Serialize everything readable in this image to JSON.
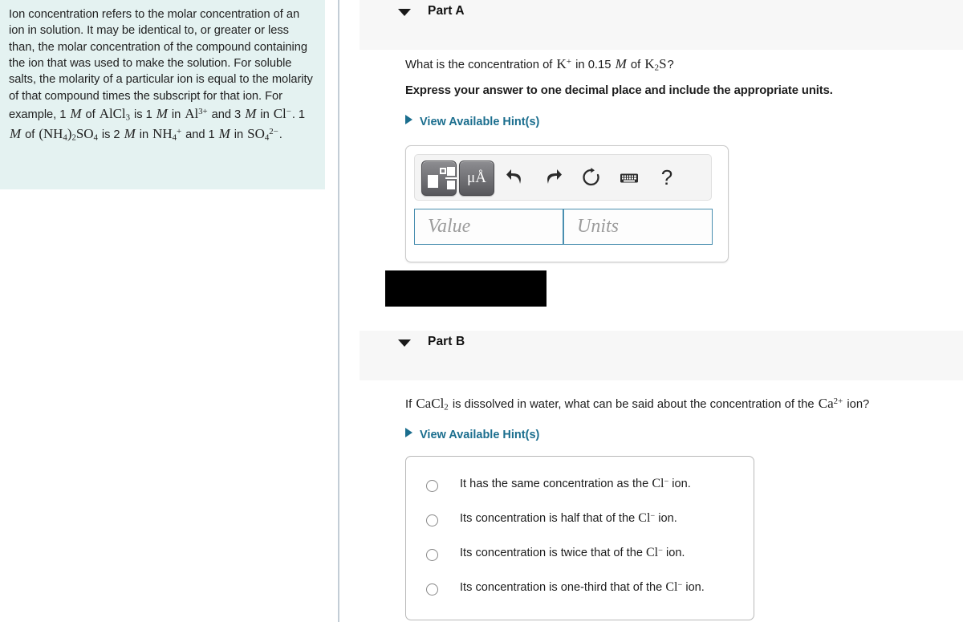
{
  "info_panel": {
    "name": "ion-concentration-definition",
    "paragraph_plain": "Ion concentration refers to the molar concentration of an ion in solution. It may be identical to, or greater or less than, the molar concentration of the compound containing the ion that was used to make the solution. For soluble salts, the molarity of a particular ion is equal to the molarity of that compound times the subscript for that ion. For example, 1 M of AlCl3 is 1 M in Al3+ and 3 M in Cl-. 1 M of (NH4)2SO4 is 2 M in NH4+ and 1 M in SO4 2-.",
    "segments": [
      "Ion concentration refers to the molar concentration of an ion in solution. It may be identical to, or greater or less than, the molar concentration of the compound containing the ion that was used to make the solution. For soluble salts, the molarity of a particular ion is equal to the molarity of that compound times the subscript for that ion. For example, 1 ",
      "M",
      " of ",
      "AlCl3",
      " is 1 ",
      "M",
      " in ",
      "Al3+",
      " and 3 ",
      "M",
      " in ",
      "Cl-",
      ". 1 ",
      "M",
      " of ",
      "(NH4)2SO4",
      " is 2 ",
      "M",
      " in ",
      "NH4+",
      " and 1 ",
      "M",
      " in ",
      "SO4 2-",
      "."
    ],
    "background_color": "#e4f2f1"
  },
  "part_a": {
    "title": "Part A",
    "caret_state": "expanded",
    "question_prefix": "What is the concentration of ",
    "question_species": "K+",
    "question_mid": " in 0.15 ",
    "question_unit": "M",
    "question_of": " of ",
    "question_compound": "K2S",
    "question_suffix": "?",
    "instruction": "Express your answer to one decimal place and include the appropriate units.",
    "hint_label": "View Available Hint(s)",
    "toolbar": {
      "template_button": "template-tool",
      "unit_button": "μÅ",
      "undo": "undo",
      "redo": "redo",
      "reset": "reset",
      "keyboard": "keyboard",
      "help": "?"
    },
    "value_input": {
      "placeholder": "Value",
      "value": ""
    },
    "units_input": {
      "placeholder": "Units",
      "value": ""
    },
    "redaction": {
      "label": "",
      "color": "#000000"
    }
  },
  "part_b": {
    "title": "Part B",
    "caret_state": "expanded",
    "question_prefix": "If ",
    "question_compound": "CaCl2",
    "question_mid": " is dissolved in water, what can be said about the concentration of the ",
    "question_species": "Ca2+",
    "question_suffix": " ion?",
    "hint_label": "View Available Hint(s)",
    "options": [
      {
        "prefix": "It has the same concentration as the ",
        "species": "Cl-",
        "suffix": " ion.",
        "selected": false
      },
      {
        "prefix": "Its concentration is half that of the ",
        "species": "Cl-",
        "suffix": " ion.",
        "selected": false
      },
      {
        "prefix": "Its concentration is twice that of the ",
        "species": "Cl-",
        "suffix": " ion.",
        "selected": false
      },
      {
        "prefix": "Its concentration is one-third that of the ",
        "species": "Cl-",
        "suffix": " ion.",
        "selected": false
      }
    ]
  },
  "colors": {
    "hint_link": "#1b6e8e",
    "input_border": "#4a8fb0",
    "header_bar": "#f7f7f7",
    "panel_bg": "#e4f2f1"
  }
}
